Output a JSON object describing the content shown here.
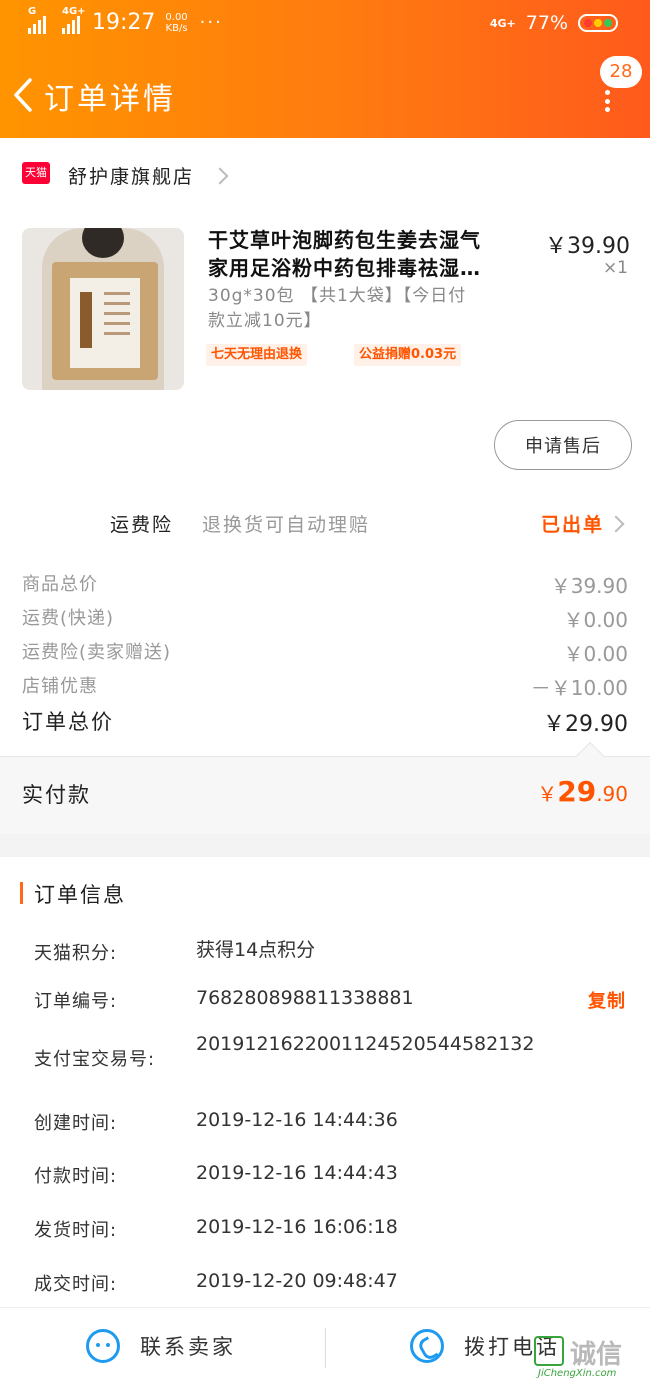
{
  "status_bar": {
    "network_left": "G",
    "network_left2": "4G+",
    "time": "19:27",
    "speed_value": "0.00",
    "speed_unit": "KB/s",
    "dots": "···",
    "network_right": "4G+",
    "battery_percent": "77%",
    "battery_colors": [
      "#ff3b30",
      "#ffcc00",
      "#34c759"
    ]
  },
  "header": {
    "title": "订单详情",
    "message_badge": "28",
    "background_start": "#ff9400",
    "background_end": "#ff5a1c"
  },
  "shop": {
    "logo_text": "天猫",
    "name": "舒护康旗舰店"
  },
  "product": {
    "title": "干艾草叶泡脚药包生姜去湿气\n家用足浴粉中药包排毒祛湿…",
    "price": "￥39.90",
    "quantity": "×1",
    "spec": "30g*30包 【共1大袋】【今日付\n款立减10元】",
    "tags": [
      "七天无理由退换",
      "公益捐赠0.03元"
    ],
    "after_sale_button": "申请售后"
  },
  "insurance": {
    "label": "运费险",
    "description": "退换货可自动理赔",
    "status": "已出单"
  },
  "fees": [
    {
      "label": "商品总价",
      "value": "￥39.90"
    },
    {
      "label": "运费(快递)",
      "value": "￥0.00"
    },
    {
      "label": "运费险(卖家赠送)",
      "value": "￥0.00"
    },
    {
      "label": "店铺优惠",
      "value": "－￥10.00"
    }
  ],
  "total": {
    "label": "订单总价",
    "value": "￥29.90"
  },
  "paid": {
    "label": "实付款",
    "symbol": "￥",
    "integer": "29",
    "decimal": ".90",
    "accent_color": "#ff5500"
  },
  "order_info": {
    "title": "订单信息",
    "rows": [
      {
        "label": "天猫积分:",
        "value": "获得14点积分"
      },
      {
        "label": "订单编号:",
        "value": "768280898811338881",
        "action": "复制"
      },
      {
        "label": "支付宝交易号:",
        "value": "2019121622001124520544582132"
      },
      {
        "label": "创建时间:",
        "value": "2019-12-16 14:44:36"
      },
      {
        "label": "付款时间:",
        "value": "2019-12-16 14:44:43"
      },
      {
        "label": "发货时间:",
        "value": "2019-12-16 16:06:18"
      },
      {
        "label": "成交时间:",
        "value": "2019-12-20 09:48:47"
      }
    ]
  },
  "bottom_bar": {
    "contact_seller": "联系卖家",
    "call_phone": "拨打电话"
  },
  "watermark": {
    "text": "诚信",
    "url": "JiChengXin.com"
  }
}
